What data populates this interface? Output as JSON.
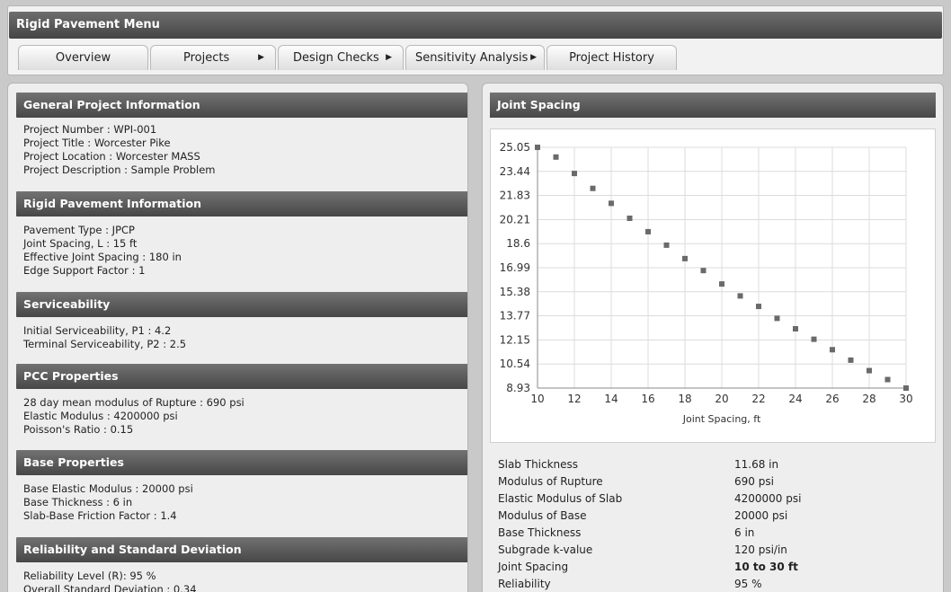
{
  "menu": {
    "title": "Rigid Pavement Menu",
    "tabs": [
      {
        "label": "Overview",
        "has_arrow": false
      },
      {
        "label": "Projects",
        "has_arrow": true
      },
      {
        "label": "Design Checks",
        "has_arrow": true
      },
      {
        "label": "Sensitivity Analysis",
        "has_arrow": true
      },
      {
        "label": "Project History",
        "has_arrow": false
      }
    ],
    "arrow_glyph": "▶"
  },
  "left": {
    "sections": [
      {
        "title": "General Project Information",
        "lines": [
          "Project Number : WPI-001",
          "Project Title : Worcester Pike",
          "Project Location : Worcester MASS",
          "Project Description : Sample Problem"
        ]
      },
      {
        "title": "Rigid Pavement Information",
        "lines": [
          "Pavement Type : JPCP",
          "Joint Spacing, L : 15 ft",
          "Effective Joint Spacing : 180 in",
          "Edge Support Factor : 1"
        ]
      },
      {
        "title": "Serviceability",
        "lines": [
          "Initial Serviceability, P1 : 4.2",
          "Terminal Serviceability, P2 : 2.5"
        ]
      },
      {
        "title": "PCC Properties",
        "lines": [
          "28 day mean modulus of Rupture : 690 psi",
          "Elastic Modulus : 4200000 psi",
          "Poisson's Ratio : 0.15"
        ]
      },
      {
        "title": "Base Properties",
        "lines": [
          "Base Elastic Modulus : 20000 psi",
          "Base Thickness : 6 in",
          "Slab-Base Friction Factor : 1.4"
        ]
      },
      {
        "title": "Reliability and Standard Deviation",
        "lines": [
          "Reliability Level (R): 95 %",
          "Overall Standard Deviation : 0.34"
        ]
      }
    ]
  },
  "right": {
    "title": "Joint Spacing",
    "results": [
      {
        "label": "Slab Thickness",
        "value": "11.68 in",
        "bold": false
      },
      {
        "label": "Modulus of Rupture",
        "value": "690 psi",
        "bold": false
      },
      {
        "label": "Elastic Modulus of Slab",
        "value": "4200000 psi",
        "bold": false
      },
      {
        "label": "Modulus of Base",
        "value": "20000 psi",
        "bold": false
      },
      {
        "label": "Base Thickness",
        "value": "6 in",
        "bold": false
      },
      {
        "label": "Subgrade k-value",
        "value": "120 psi/in",
        "bold": false
      },
      {
        "label": "Joint Spacing",
        "value": "10 to 30 ft",
        "bold": true
      },
      {
        "label": "Reliability",
        "value": "95 %",
        "bold": false
      }
    ]
  },
  "chart_data": {
    "type": "scatter",
    "title": "",
    "xlabel": "Joint Spacing, ft",
    "ylabel": "",
    "xlim": [
      10,
      30
    ],
    "ylim": [
      8.93,
      25.05
    ],
    "x_ticks": [
      "10",
      "12",
      "14",
      "16",
      "18",
      "20",
      "22",
      "24",
      "26",
      "28",
      "30"
    ],
    "y_ticks": [
      "8.93",
      "10.54",
      "12.15",
      "13.77",
      "15.38",
      "16.99",
      "18.6",
      "20.21",
      "21.83",
      "23.44",
      "25.05"
    ],
    "grid": true,
    "marker_color": "#6a6a6a",
    "series": [
      {
        "x": [
          10,
          11,
          12,
          13,
          14,
          15,
          16,
          17,
          18,
          19,
          20,
          21,
          22,
          23,
          24,
          25,
          26,
          27,
          28,
          29,
          30
        ],
        "y": [
          25.05,
          24.4,
          23.3,
          22.3,
          21.3,
          20.3,
          19.4,
          18.5,
          17.6,
          16.8,
          15.9,
          15.1,
          14.4,
          13.6,
          12.9,
          12.2,
          11.5,
          10.8,
          10.1,
          9.5,
          8.93
        ]
      }
    ]
  }
}
